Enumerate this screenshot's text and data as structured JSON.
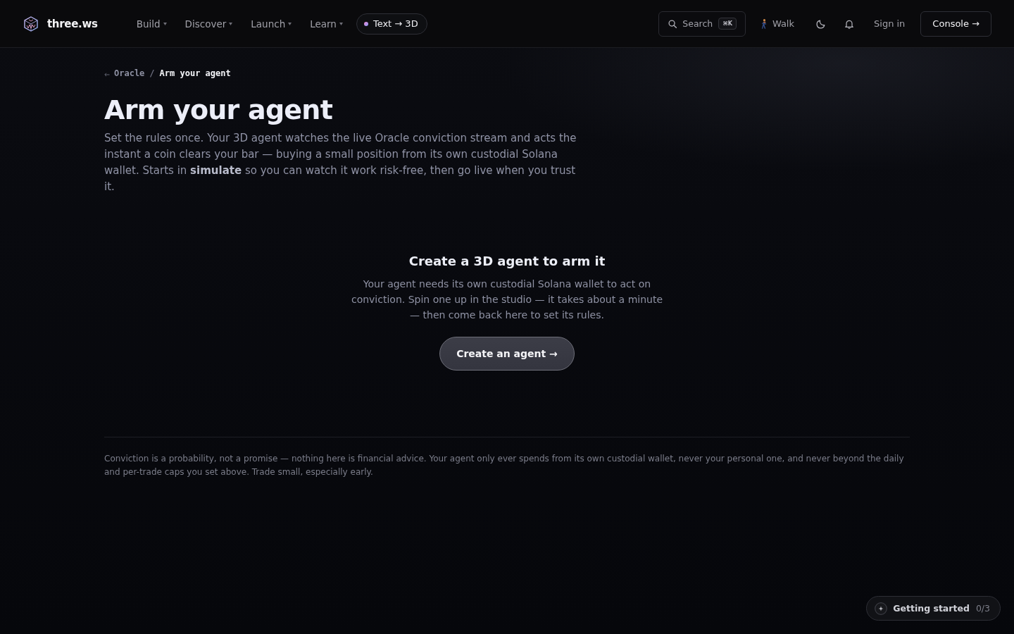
{
  "header": {
    "logo": "three.ws",
    "nav": [
      {
        "label": "Build"
      },
      {
        "label": "Discover"
      },
      {
        "label": "Launch"
      },
      {
        "label": "Learn"
      }
    ],
    "feature_link": "Text → 3D",
    "search": {
      "label": "Search",
      "shortcut": "⌘K"
    },
    "walk": "Walk",
    "sign_in": "Sign in",
    "console": "Console →"
  },
  "breadcrumb": {
    "parent": "Oracle",
    "separator": "/",
    "current": "Arm your agent"
  },
  "title": "Arm your agent",
  "intro": "Set the rules once. Your 3D agent watches the live Oracle conviction stream and acts the instant a coin clears your bar — buying a small position from its own custodial Solana wallet. Starts in **simulate** so you can watch it work risk-free, then go live when you trust it.",
  "empty_state": {
    "heading": "Create a 3D agent to arm it",
    "text": "Your agent needs its own custodial Solana wallet to act on conviction. Spin one up in the studio — it takes about a minute — then come back here to set its rules.",
    "button": "Create an agent →"
  },
  "disclaimer": "Conviction is a probability, not a promise — nothing here is financial advice. Your agent only ever spends from its own custodial wallet, never your personal one, and never beyond the daily and per-trade caps you set above. Trade small, especially early.",
  "getting_started": {
    "label": "Getting started",
    "progress": "0/3"
  }
}
